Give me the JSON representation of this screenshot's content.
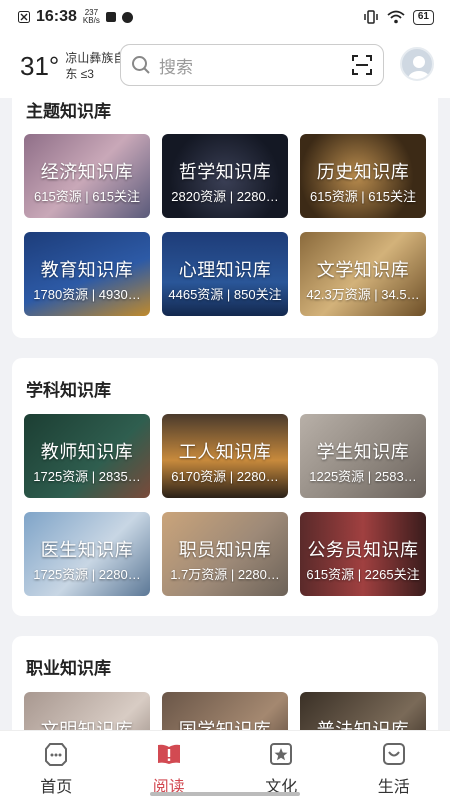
{
  "status": {
    "time": "16:38",
    "speed_top": "237",
    "speed_unit": "KB/s",
    "battery": "61"
  },
  "header": {
    "temperature": "31°",
    "location_line1": "凉山彝族自治州",
    "location_line2": "东 ≤3",
    "search_placeholder": "搜索"
  },
  "sections": [
    {
      "title": "主题知识库",
      "tiles": [
        {
          "title": "经济知识库",
          "sub": "615资源 | 615关注"
        },
        {
          "title": "哲学知识库",
          "sub": "2820资源 | 2280…"
        },
        {
          "title": "历史知识库",
          "sub": "615资源 | 615关注"
        },
        {
          "title": "教育知识库",
          "sub": "1780资源 | 4930…"
        },
        {
          "title": "心理知识库",
          "sub": "4465资源 | 850关注"
        },
        {
          "title": "文学知识库",
          "sub": "42.3万资源 | 34.5…"
        }
      ]
    },
    {
      "title": "学科知识库",
      "tiles": [
        {
          "title": "教师知识库",
          "sub": "1725资源 | 2835…"
        },
        {
          "title": "工人知识库",
          "sub": "6170资源 | 2280…"
        },
        {
          "title": "学生知识库",
          "sub": "1225资源 | 2583…"
        },
        {
          "title": "医生知识库",
          "sub": "1725资源 | 2280…"
        },
        {
          "title": "职员知识库",
          "sub": "1.7万资源 | 2280…"
        },
        {
          "title": "公务员知识库",
          "sub": "615资源 | 2265关注"
        }
      ]
    },
    {
      "title": "职业知识库",
      "tiles": [
        {
          "title": "文明知识库",
          "sub": ""
        },
        {
          "title": "国学知识库",
          "sub": ""
        },
        {
          "title": "普法知识库",
          "sub": ""
        }
      ]
    }
  ],
  "nav": [
    {
      "label": "首页",
      "icon": "home-icon"
    },
    {
      "label": "阅读",
      "icon": "read-icon"
    },
    {
      "label": "文化",
      "icon": "culture-icon"
    },
    {
      "label": "生活",
      "icon": "life-icon"
    }
  ],
  "colors": {
    "active": "#d24a52",
    "inactive": "#666666"
  }
}
